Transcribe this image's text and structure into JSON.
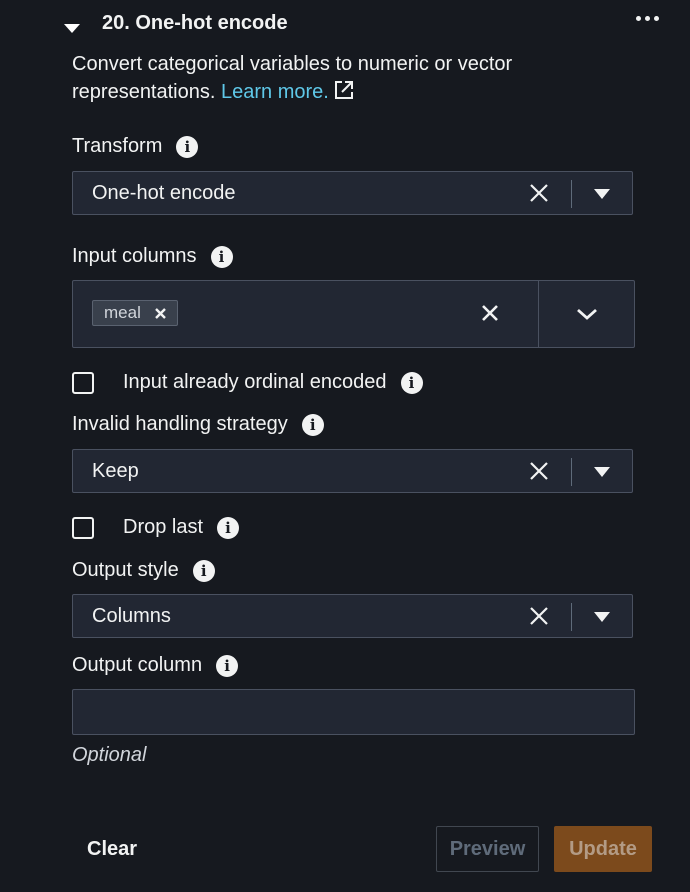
{
  "header": {
    "title": "20. One-hot encode"
  },
  "description": {
    "text": "Convert categorical variables to numeric or vector representations.",
    "learn_more": "Learn more."
  },
  "transform": {
    "label": "Transform",
    "value": "One-hot encode"
  },
  "input_columns": {
    "label": "Input columns",
    "tokens": [
      "meal"
    ]
  },
  "ordinal_checkbox": {
    "label": "Input already ordinal encoded",
    "checked": false
  },
  "invalid_handling": {
    "label": "Invalid handling strategy",
    "value": "Keep"
  },
  "drop_last": {
    "label": "Drop last",
    "checked": false
  },
  "output_style": {
    "label": "Output style",
    "value": "Columns"
  },
  "output_column": {
    "label": "Output column",
    "value": "",
    "hint": "Optional"
  },
  "footer": {
    "clear_label": "Clear",
    "preview_label": "Preview",
    "update_label": "Update"
  },
  "colors": {
    "background": "#16191f",
    "link": "#5fc8e8",
    "update_button": "#7c4a1c"
  }
}
